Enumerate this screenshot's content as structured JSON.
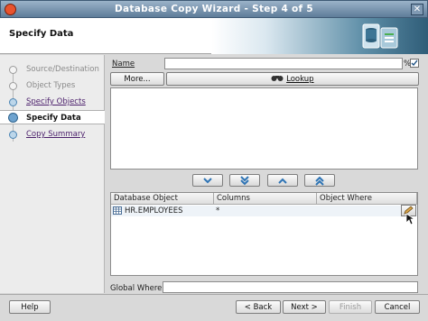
{
  "window": {
    "title": "Database Copy Wizard - Step 4 of 5",
    "close_glyph": "✕"
  },
  "header": {
    "title": "Specify Data"
  },
  "steps": [
    {
      "label": "Source/Destination",
      "state": "done"
    },
    {
      "label": "Object Types",
      "state": "done"
    },
    {
      "label": "Specify Objects",
      "state": "link"
    },
    {
      "label": "Specify Data",
      "state": "current"
    },
    {
      "label": "Copy Summary",
      "state": "link"
    }
  ],
  "form": {
    "name_label": "Name",
    "name_value": "",
    "name_suffix": "%",
    "more_button": "More...",
    "lookup_button": "Lookup",
    "global_where_label": "Global Where:",
    "global_where_value": ""
  },
  "move_buttons": [
    {
      "name": "move-down-button",
      "icon": "chevron-down-icon"
    },
    {
      "name": "move-all-down-button",
      "icon": "double-chevron-down-icon"
    },
    {
      "name": "move-up-button",
      "icon": "chevron-up-icon"
    },
    {
      "name": "move-all-up-button",
      "icon": "double-chevron-up-icon"
    }
  ],
  "table": {
    "columns": [
      "Database Object",
      "Columns",
      "Object Where"
    ],
    "rows": [
      {
        "object": "HR.EMPLOYEES",
        "columns": "*",
        "where": ""
      }
    ]
  },
  "footer": {
    "help": "Help",
    "back": "< Back",
    "next": "Next >",
    "finish": "Finish",
    "cancel": "Cancel"
  },
  "colors": {
    "accent": "#5e7c99",
    "link": "#4b1f6b",
    "arrow": "#2e74b5"
  }
}
